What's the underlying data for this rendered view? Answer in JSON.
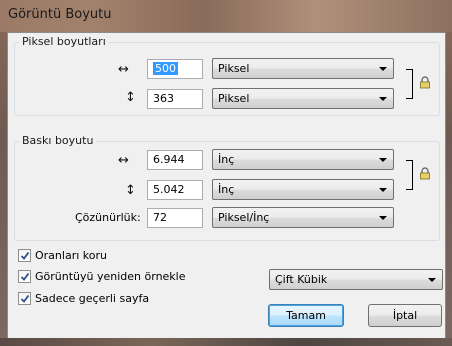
{
  "window": {
    "title": "Görüntü Boyutu"
  },
  "pixel_group": {
    "legend": "Piksel boyutları",
    "width": {
      "glyph": "↔",
      "value": "500",
      "unit": "Piksel"
    },
    "height": {
      "glyph": "↕",
      "value": "363",
      "unit": "Piksel"
    }
  },
  "print_group": {
    "legend": "Baskı boyutu",
    "width": {
      "glyph": "↔",
      "value": "6.944",
      "unit": "İnç"
    },
    "height": {
      "glyph": "↕",
      "value": "5.042",
      "unit": "İnç"
    },
    "resolution": {
      "label": "Çözünürlük:",
      "value": "72",
      "unit": "Piksel/İnç"
    }
  },
  "options": {
    "keep_ratio": {
      "label": "Oranları koru",
      "checked": true
    },
    "resample": {
      "label": "Görüntüyü yeniden örnekle",
      "checked": true
    },
    "current_page": {
      "label": "Sadece geçerli sayfa",
      "checked": true
    },
    "resample_method": "Çift Kübik"
  },
  "buttons": {
    "ok": "Tamam",
    "cancel": "İptal"
  }
}
